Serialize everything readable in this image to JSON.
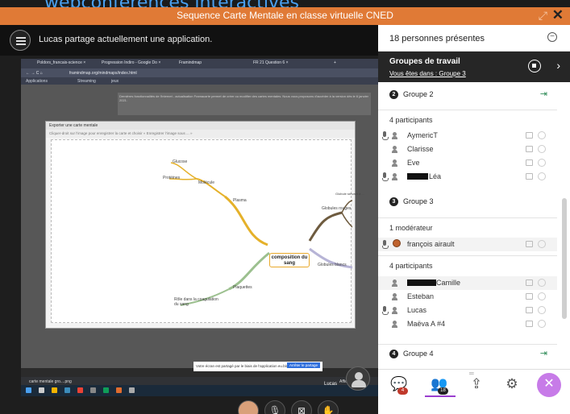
{
  "window": {
    "top_text": "webconférences interactives",
    "title": "Sequence Carte Mentale en classe virtuelle CNED"
  },
  "share": {
    "text": "Lucas partage actuellement une application."
  },
  "browser": {
    "tabs": [
      "Poldors_francais-science ×",
      "Progression Indiro - Google Do ×",
      "Framindmap",
      "FR 21 Question 6 ×",
      "+"
    ],
    "address": "framindmap.org/mindmaps/index.html",
    "bookmarks": [
      "Applications",
      "Streaming",
      "jeux"
    ],
    "page_text": "Dernières fonctionnalités de l'internet - actualisation Framacarte permet de créer ou modifier des cartes mentales. Nous vous proposons d'accéder à la version dès le 6 janvier 2021.",
    "modal_title": "Exporter une carte mentale",
    "modal_hint": "Cliquer-droit sur l'image pour enregistrer la carte et choisir « Enregistrer l'image sous ... »",
    "mindmap": {
      "center": "composition du sang",
      "nodes": [
        "Glucose",
        "Protéines",
        "Molécule",
        "Plasma",
        "Globules rouges",
        "Globule servant à ...",
        "Globules blancs",
        "Plaquettes",
        "Rôle dans la coagulation du sang"
      ]
    },
    "notice": "Votre écran est partagé par le biais de l'application eu.blackboard.com",
    "notice_button": "Arrêter le partage",
    "download_file": "carte mentale gro....png",
    "download_all": "Afficher tout",
    "presenter": "Lucas"
  },
  "panel": {
    "header": "18 personnes présentes",
    "groups_title": "Groupes de travail",
    "groups_sub": "Vous êtes dans : Groupe 3",
    "group2": {
      "num": "2",
      "label": "Groupe 2",
      "participants_head": "4 participants",
      "members": [
        "AymericT",
        "Clarisse",
        "Eve",
        "Léa"
      ]
    },
    "group3": {
      "num": "3",
      "label": "Groupe 3",
      "moderator_head": "1 modérateur",
      "moderator": "françois airault",
      "participants_head": "4 participants",
      "members": [
        "Camille",
        "Esteban",
        "Lucas",
        "Maëva A #4"
      ]
    },
    "group4": {
      "num": "4",
      "label": "Groupe 4"
    },
    "tabs": {
      "chat_badge": "4",
      "people_badge": "18"
    }
  }
}
